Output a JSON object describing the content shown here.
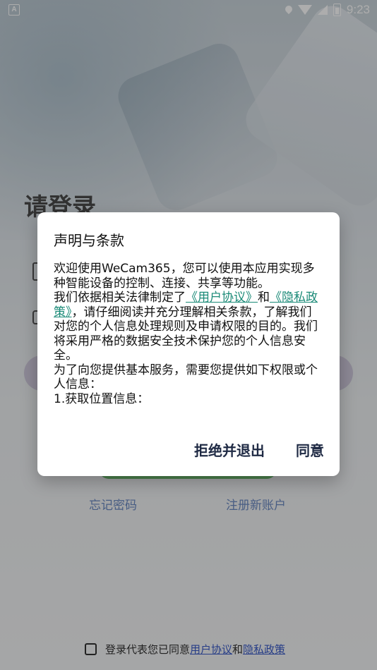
{
  "status_bar": {
    "time": "9:23",
    "left_icon": "A"
  },
  "login": {
    "title": "请登录",
    "forgot_password": "忘记密码",
    "register": "注册新账户",
    "agreement_prefix": "登录代表您已同意",
    "agreement_user": "用户协议",
    "agreement_and": "和",
    "agreement_privacy": "隐私政策"
  },
  "dialog": {
    "title": "声明与条款",
    "line1": "欢迎使用WeCam365，您可以使用本应用实现多种智能设备的控制、连接、共享等功能。",
    "line2_pre": "我们依据相关法律制定了",
    "user_agreement_link": "《用户协议》",
    "line2_and": "和",
    "privacy_link": "《隐私政策》",
    "line2_post": "，请仔细阅读并充分理解相关条款，了解我们对您的个人信息处理规则及申请权限的目的。我们将采用严格的数据安全技术保护您的个人信息安全。",
    "line3": "为了向您提供基本服务，需要您提供如下权限或个人信息：",
    "line4": "1.获取位置信息：",
    "decline_button": "拒绝并退出",
    "agree_button": "同意"
  }
}
